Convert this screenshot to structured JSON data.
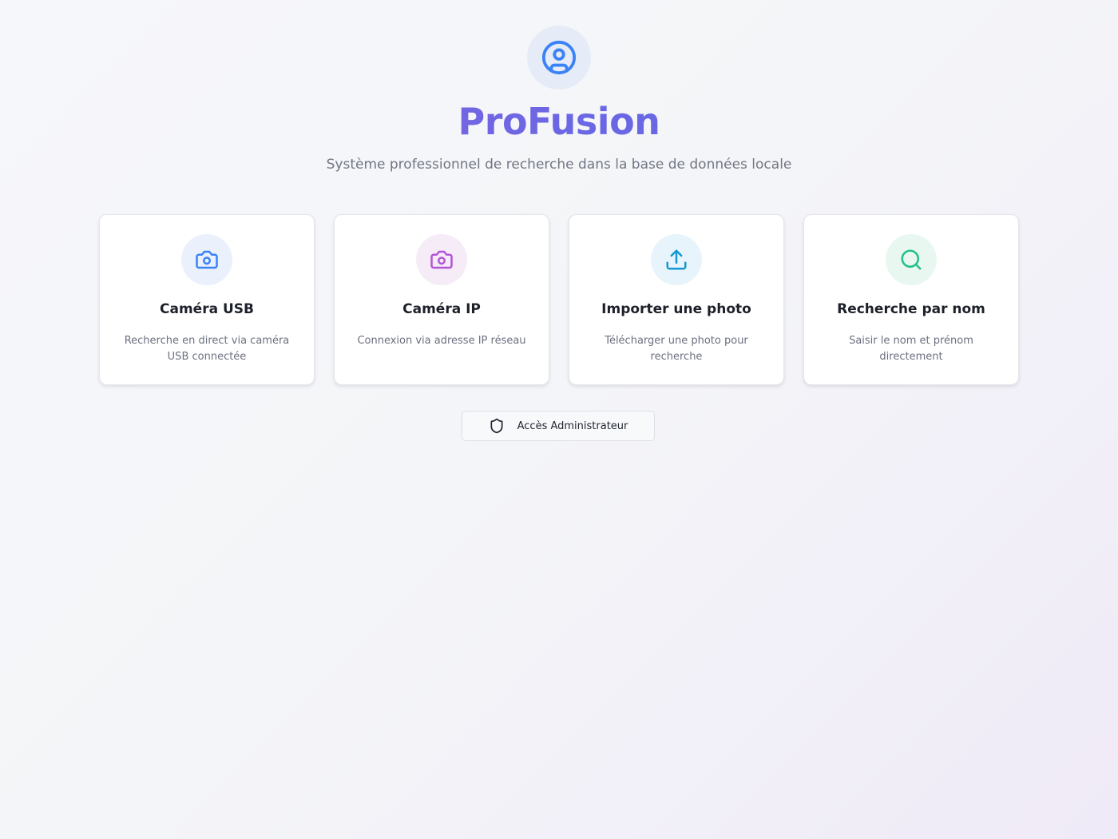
{
  "brand": {
    "logo_icon": "user-circle-icon",
    "title": "ProFusion",
    "subtitle": "Système professionnel de recherche dans la base de données locale"
  },
  "cards": [
    {
      "icon": "camera-icon",
      "title": "Caméra USB",
      "description": "Recherche en direct via caméra USB connectée",
      "accent": "#3b82f6",
      "icon_bg": "#eaf1fc"
    },
    {
      "icon": "camera-icon",
      "title": "Caméra IP",
      "description": "Connexion via adresse IP réseau",
      "accent": "#b455d6",
      "icon_bg": "#f6ecf8"
    },
    {
      "icon": "upload-icon",
      "title": "Importer une photo",
      "description": "Télécharger une photo pour recherche",
      "accent": "#1597d4",
      "icon_bg": "#e8f4fb"
    },
    {
      "icon": "search-icon",
      "title": "Recherche par nom",
      "description": "Saisir le nom et prénom directement",
      "accent": "#22c08a",
      "icon_bg": "#e8f8f1"
    }
  ],
  "admin": {
    "icon": "shield-icon",
    "label": "Accès Administrateur"
  },
  "colors": {
    "brand_gradient_start": "#8a62de",
    "brand_gradient_end": "#5f6fe2",
    "logo_accent": "#3b82f6"
  }
}
